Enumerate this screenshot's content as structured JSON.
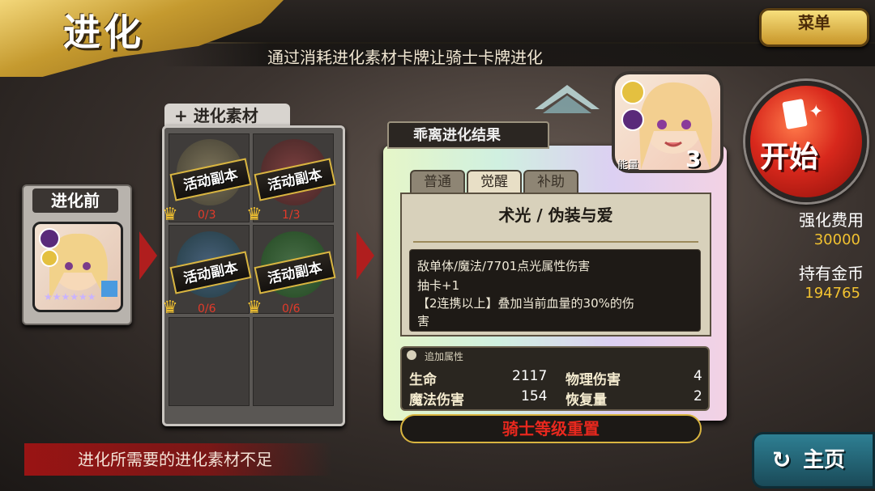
{
  "header": {
    "title": "进化",
    "subtitle": "通过消耗进化素材卡牌让骑士卡牌进化",
    "menu_label": "菜单"
  },
  "pre_evolution": {
    "label": "进化前",
    "stars": "★★★★★★"
  },
  "materials": {
    "tab_label": "+ 进化素材",
    "slots": [
      {
        "banner": "活动副本",
        "count": "0/3"
      },
      {
        "banner": "活动副本",
        "count": "1/3"
      },
      {
        "banner": "活动副本",
        "count": "0/6"
      },
      {
        "banner": "活动副本",
        "count": "0/6"
      }
    ]
  },
  "warning": "进化所需要的进化素材不足",
  "result": {
    "header": "乖离进化结果",
    "tabs": [
      "普通",
      "觉醒",
      "补助"
    ],
    "skill_title": "术光 / 伪装与爱",
    "desc": [
      "敌单体/魔法/7701点光属性伤害",
      "抽卡+1",
      "【2连携以上】叠加当前血量的30%的伤",
      "害"
    ],
    "stats_header": "追加属性",
    "stats": [
      {
        "label": "生命",
        "value": "2117"
      },
      {
        "label": "物理伤害",
        "value": "4"
      },
      {
        "label": "魔法伤害",
        "value": "154"
      },
      {
        "label": "恢复量",
        "value": "2"
      }
    ],
    "reset": "骑士等级重置"
  },
  "avatar": {
    "name": "能量",
    "count": "3"
  },
  "start_label": "开始",
  "cost": {
    "label": "强化费用",
    "value": "30000"
  },
  "gold": {
    "label": "持有金币",
    "value": "194765"
  },
  "home_label": "主页",
  "colors": {
    "accent_gold": "#f2c230",
    "warning_red": "#b01e1e",
    "reset_red": "#e8281e"
  }
}
